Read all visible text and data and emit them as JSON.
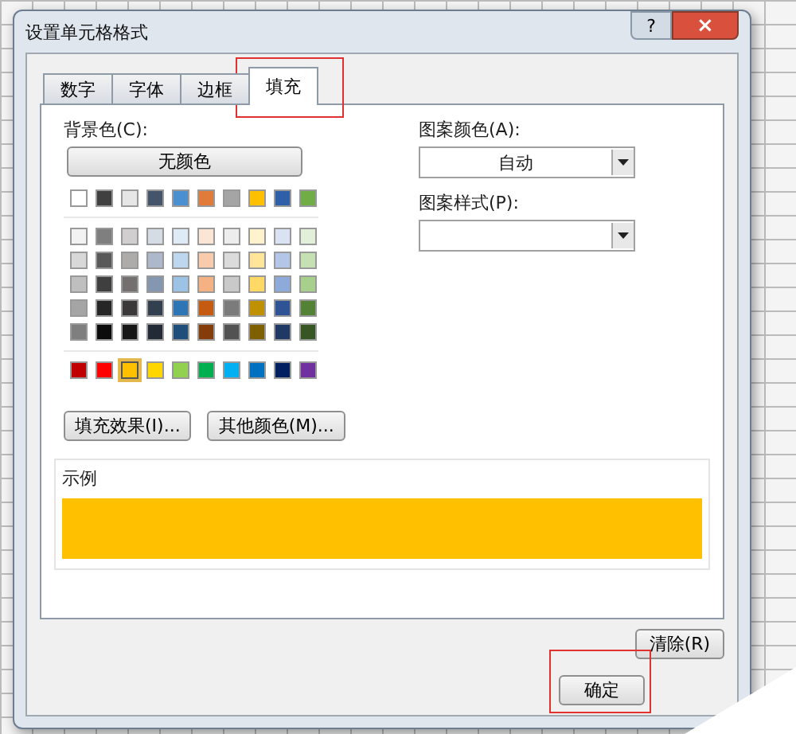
{
  "window": {
    "title": "设置单元格格式",
    "help": "?",
    "close": "×"
  },
  "tabs": [
    {
      "label": "数字",
      "selected": false
    },
    {
      "label": "字体",
      "selected": false
    },
    {
      "label": "边框",
      "selected": false
    },
    {
      "label": "填充",
      "selected": true,
      "highlighted": true
    }
  ],
  "background": {
    "label": "背景色(C):",
    "no_color": "无颜色",
    "theme_row": [
      {
        "color": "#ffffff",
        "selected": false
      },
      {
        "color": "#404040",
        "selected": false
      },
      {
        "color": "#e6e6e6",
        "selected": false
      },
      {
        "color": "#44546a",
        "selected": false
      },
      {
        "color": "#4a90d0",
        "selected": false
      },
      {
        "color": "#e07b39",
        "selected": false
      },
      {
        "color": "#a5a5a5",
        "selected": false
      },
      {
        "color": "#ffc000",
        "selected": false
      },
      {
        "color": "#2e5fa8",
        "selected": false
      },
      {
        "color": "#70ad47",
        "selected": false
      }
    ],
    "tint_rows": [
      [
        {
          "color": "#f2f2f2",
          "selected": false
        },
        {
          "color": "#7f7f7f",
          "selected": false
        },
        {
          "color": "#d0cece",
          "selected": false
        },
        {
          "color": "#d6dce4",
          "selected": false
        },
        {
          "color": "#deebf6",
          "selected": false
        },
        {
          "color": "#fbe5d5",
          "selected": false
        },
        {
          "color": "#ededed",
          "selected": false
        },
        {
          "color": "#fff2cc",
          "selected": false
        },
        {
          "color": "#dae3f3",
          "selected": false
        },
        {
          "color": "#e2efd9",
          "selected": false
        }
      ],
      [
        {
          "color": "#d8d8d8",
          "selected": false
        },
        {
          "color": "#595959",
          "selected": false
        },
        {
          "color": "#aeabab",
          "selected": false
        },
        {
          "color": "#adb9ca",
          "selected": false
        },
        {
          "color": "#bdd7ee",
          "selected": false
        },
        {
          "color": "#f7cbac",
          "selected": false
        },
        {
          "color": "#dbdbdb",
          "selected": false
        },
        {
          "color": "#fee599",
          "selected": false
        },
        {
          "color": "#b4c6e7",
          "selected": false
        },
        {
          "color": "#c5e0b3",
          "selected": false
        }
      ],
      [
        {
          "color": "#bfbfbf",
          "selected": false
        },
        {
          "color": "#3f3f3f",
          "selected": false
        },
        {
          "color": "#757070",
          "selected": false
        },
        {
          "color": "#8496b0",
          "selected": false
        },
        {
          "color": "#9cc3e5",
          "selected": false
        },
        {
          "color": "#f4b183",
          "selected": false
        },
        {
          "color": "#c9c9c9",
          "selected": false
        },
        {
          "color": "#ffd965",
          "selected": false
        },
        {
          "color": "#8eaadb",
          "selected": false
        },
        {
          "color": "#a8d08d",
          "selected": false
        }
      ],
      [
        {
          "color": "#a5a5a5",
          "selected": false
        },
        {
          "color": "#262626",
          "selected": false
        },
        {
          "color": "#3a3838",
          "selected": false
        },
        {
          "color": "#323f4f",
          "selected": false
        },
        {
          "color": "#2e75b5",
          "selected": false
        },
        {
          "color": "#c55a11",
          "selected": false
        },
        {
          "color": "#7b7b7b",
          "selected": false
        },
        {
          "color": "#bf9000",
          "selected": false
        },
        {
          "color": "#2f5496",
          "selected": false
        },
        {
          "color": "#538135",
          "selected": false
        }
      ],
      [
        {
          "color": "#7f7f7f",
          "selected": false
        },
        {
          "color": "#0c0c0c",
          "selected": false
        },
        {
          "color": "#171616",
          "selected": false
        },
        {
          "color": "#222a35",
          "selected": false
        },
        {
          "color": "#1e4e79",
          "selected": false
        },
        {
          "color": "#843c0b",
          "selected": false
        },
        {
          "color": "#525252",
          "selected": false
        },
        {
          "color": "#7f6000",
          "selected": false
        },
        {
          "color": "#1f3864",
          "selected": false
        },
        {
          "color": "#375623",
          "selected": false
        }
      ]
    ],
    "standard_row": [
      {
        "color": "#c00000",
        "selected": false
      },
      {
        "color": "#ff0000",
        "selected": false
      },
      {
        "color": "#ffc000",
        "selected": true
      },
      {
        "color": "#ffd700",
        "selected": false
      },
      {
        "color": "#92d050",
        "selected": false
      },
      {
        "color": "#00b050",
        "selected": false
      },
      {
        "color": "#00b0f0",
        "selected": false
      },
      {
        "color": "#0070c0",
        "selected": false
      },
      {
        "color": "#002060",
        "selected": false
      },
      {
        "color": "#7030a0",
        "selected": false
      }
    ],
    "fill_effects": "填充效果(I)...",
    "more_colors": "其他颜色(M)..."
  },
  "pattern": {
    "color_label": "图案颜色(A):",
    "color_value": "自动",
    "style_label": "图案样式(P):"
  },
  "sample": {
    "label": "示例",
    "color": "#ffc000"
  },
  "buttons": {
    "clear": "清除(R)",
    "ok": "确定",
    "ok_highlighted": true
  }
}
